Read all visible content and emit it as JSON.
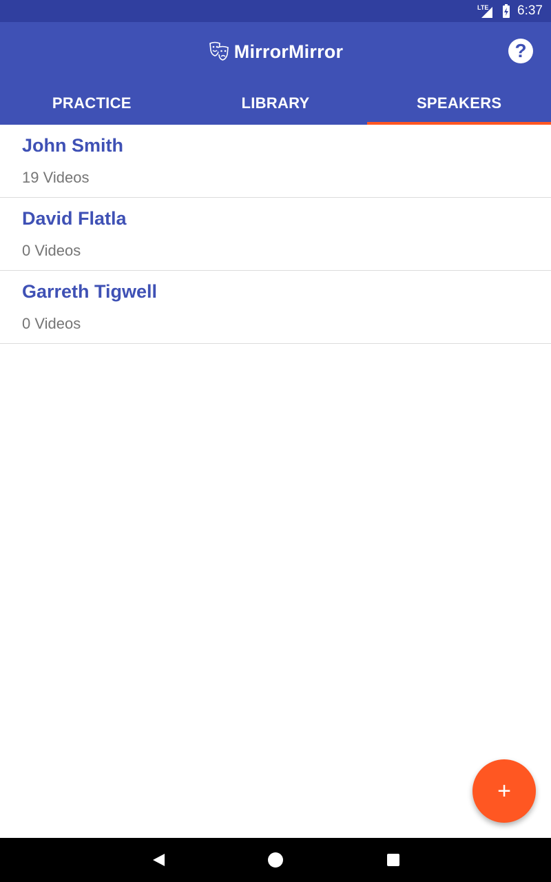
{
  "status_bar": {
    "network_label": "LTE",
    "time": "6:37",
    "network_icon": "signal-icon",
    "battery_icon": "battery-charging-icon"
  },
  "app_bar": {
    "title": "MirrorMirror",
    "logo_icon": "theater-masks-icon",
    "help_icon": "help-icon",
    "help_label": "?"
  },
  "tabs": [
    {
      "label": "PRACTICE",
      "active": false
    },
    {
      "label": "LIBRARY",
      "active": false
    },
    {
      "label": "SPEAKERS",
      "active": true
    }
  ],
  "speakers": [
    {
      "name": "John Smith",
      "count": "19 Videos"
    },
    {
      "name": "David Flatla",
      "count": "0 Videos"
    },
    {
      "name": "Garreth Tigwell",
      "count": "0 Videos"
    }
  ],
  "fab": {
    "icon": "plus-icon",
    "label": "+"
  },
  "colors": {
    "primary": "#3F51B5",
    "primary_dark": "#303F9F",
    "accent": "#FF5722"
  }
}
